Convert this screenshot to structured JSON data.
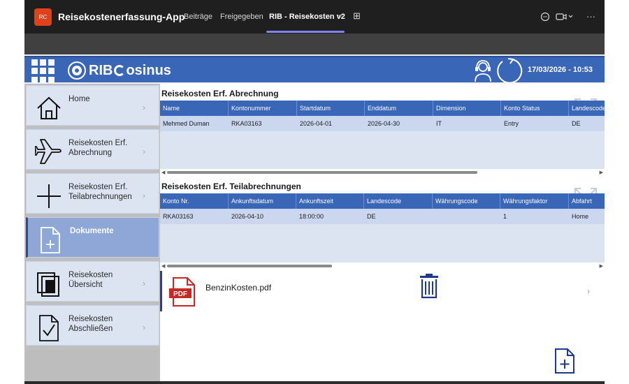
{
  "teams": {
    "app_badge": "RC",
    "app_title": "Reisekostenerfassung-App",
    "tabs": [
      "Beiträge",
      "Freigegeben",
      "RIB - Reisekosten v2"
    ],
    "active_tab_chevron": "⌵",
    "add_tab": "⊞",
    "chat_icon": "chat-icon",
    "video_icon": "video-icon",
    "more": "···"
  },
  "header": {
    "logo_text": "RIB",
    "logo_suffix": "osinus",
    "datetime": "17/03/2026 - 10:53",
    "accent": "#3a66b8"
  },
  "sidebar": {
    "items": [
      {
        "label": "Home",
        "icon": "home-icon",
        "active": false
      },
      {
        "label": "Reisekosten Erf. Abrechnung",
        "icon": "airplane-icon",
        "active": false
      },
      {
        "label": "Reisekosten Erf. Teilabrechnungen",
        "icon": "plus-icon",
        "active": false
      },
      {
        "label": "Dokumente",
        "icon": "document-add-icon",
        "active": true
      },
      {
        "label": "Reisekosten Übersicht",
        "icon": "copy-icon",
        "active": false
      },
      {
        "label": "Reisekosten Abschließen",
        "icon": "checklist-icon",
        "active": false
      }
    ],
    "chevron": "›"
  },
  "abrechnung": {
    "title": "Reisekosten Erf. Abrechnung",
    "columns": [
      "Name",
      "Kontonummer",
      "Startdatum",
      "Enddatum",
      "Dimension",
      "Konto Status",
      "Landescode"
    ],
    "row": [
      "Mehmed Duman",
      "RKA03163",
      "2026-04-01",
      "2026-04-30",
      "IT",
      "Entry",
      "DE"
    ]
  },
  "teilabrechnungen": {
    "title": "Reisekosten Erf. Teilabrechnungen",
    "columns": [
      "Konto Nr.",
      "Ankunftsdatum",
      "Ankunftszeit",
      "Landescode",
      "Währungscode",
      "Währungsfaktor",
      "Abfahrt"
    ],
    "row": [
      "RKA03163",
      "2026-04-10",
      "18:00:00",
      "DE",
      "",
      "1",
      "Home"
    ]
  },
  "documents": {
    "items": [
      {
        "name": "BenzinKosten.pdf",
        "type_label": "PDF"
      }
    ],
    "chevron": "›"
  },
  "scroll": {
    "left": "◀",
    "right": "▶"
  }
}
